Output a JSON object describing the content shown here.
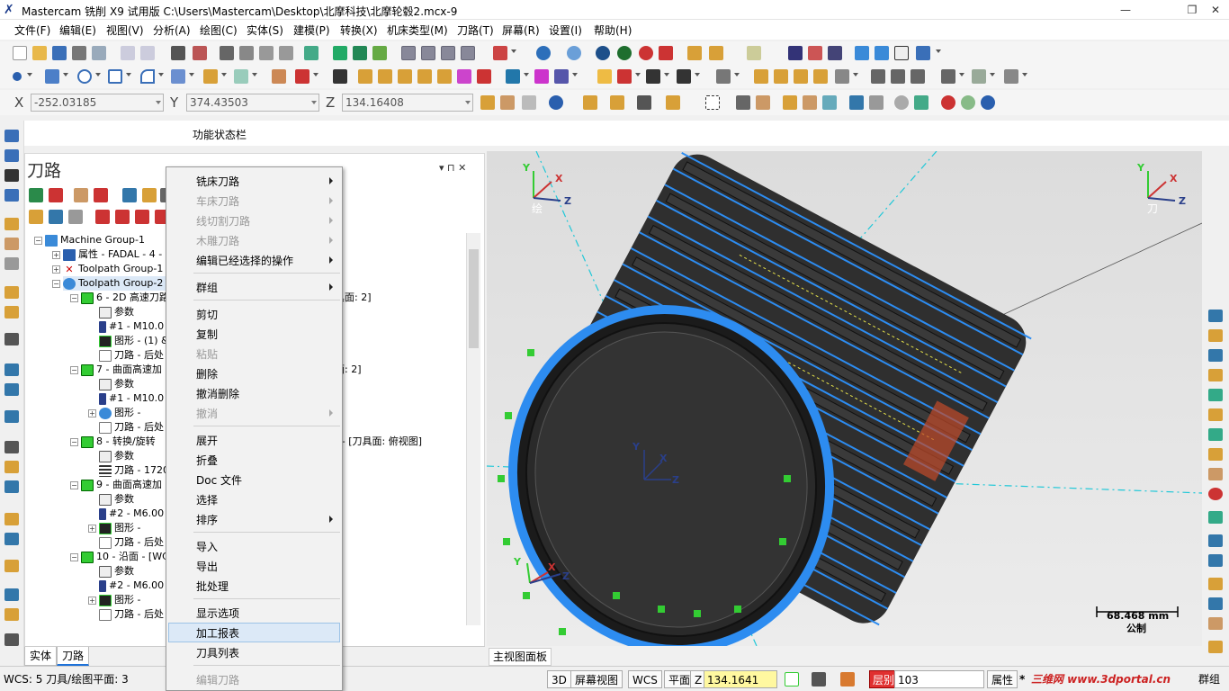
{
  "window": {
    "title": "Mastercam 铣削 X9 试用版  C:\\Users\\Mastercam\\Desktop\\北摩科技\\北摩轮毂2.mcx-9",
    "minimize": "—",
    "restore": "❐",
    "close": "✕"
  },
  "menu": [
    "文件(F)",
    "编辑(E)",
    "视图(V)",
    "分析(A)",
    "绘图(C)",
    "实体(S)",
    "建模(P)",
    "转换(X)",
    "机床类型(M)",
    "刀路(T)",
    "屏幕(R)",
    "设置(I)",
    "帮助(H)"
  ],
  "coords": {
    "x_label": "X",
    "x": "-252.03185",
    "y_label": "Y",
    "y": "374.43503",
    "z_label": "Z",
    "z": "134.16408"
  },
  "func_bar": "功能状态栏",
  "panel": {
    "title": "刀路",
    "pin": "▾ ⊓ ✕",
    "tree": [
      "Machine Group-1",
      "属性 - FADAL - 4 -",
      "Toolpath Group-1",
      "Toolpath Group-2",
      "6 - 2D 高速刀路",
      "参数",
      "#1 - M10.0",
      "图形 - (1) &",
      "刀路 - 后处",
      "7 - 曲面高速加",
      "参数",
      "#1 - M10.0",
      "图形 -",
      "刀路 - 后处",
      "8 - 转换/旋转",
      "参数",
      "刀路 - 1720",
      "9 - 曲面高速加",
      "参数",
      "#2 - M6.00",
      "图形 -",
      "刀路 - 后处",
      "10 - 沿面 - [WC",
      "参数",
      "#2 - M6.00",
      "图形 -",
      "刀路 - 后处"
    ],
    "tree_suffix": {
      "r6": "具面: 2]",
      "r7": "面: 2]",
      "r8": "] - [刀具面: 俯视图]",
      "r9": "]"
    },
    "tabs": [
      "实体",
      "刀路"
    ]
  },
  "context_menu": {
    "items": [
      {
        "label": "铣床刀路",
        "disabled": false,
        "sub": true
      },
      {
        "label": "车床刀路",
        "disabled": true,
        "sub": true
      },
      {
        "label": "线切割刀路",
        "disabled": true,
        "sub": true
      },
      {
        "label": "木雕刀路",
        "disabled": true,
        "sub": true
      },
      {
        "label": "编辑已经选择的操作",
        "disabled": false,
        "sub": true
      },
      {
        "label": "群组",
        "disabled": false,
        "sub": true
      },
      {
        "label": "剪切",
        "disabled": false,
        "sub": false
      },
      {
        "label": "复制",
        "disabled": false,
        "sub": false
      },
      {
        "label": "粘贴",
        "disabled": true,
        "sub": false
      },
      {
        "label": "删除",
        "disabled": false,
        "sub": false
      },
      {
        "label": "撤消删除",
        "disabled": false,
        "sub": false
      },
      {
        "label": "撤消",
        "disabled": true,
        "sub": true
      },
      {
        "label": "展开",
        "disabled": false,
        "sub": false
      },
      {
        "label": "折叠",
        "disabled": false,
        "sub": false
      },
      {
        "label": "Doc 文件",
        "disabled": false,
        "sub": false
      },
      {
        "label": "选择",
        "disabled": false,
        "sub": false
      },
      {
        "label": "排序",
        "disabled": false,
        "sub": true
      },
      {
        "label": "导入",
        "disabled": false,
        "sub": false
      },
      {
        "label": "导出",
        "disabled": false,
        "sub": false
      },
      {
        "label": "批处理",
        "disabled": false,
        "sub": false
      },
      {
        "label": "显示选项",
        "disabled": false,
        "sub": false
      },
      {
        "label": "加工报表",
        "disabled": false,
        "sub": false,
        "highlight": true
      },
      {
        "label": "刀具列表",
        "disabled": false,
        "sub": false
      },
      {
        "label": "编辑刀路",
        "disabled": true,
        "sub": false
      }
    ]
  },
  "viewport": {
    "view_left": "绘",
    "view_right": "刀",
    "scale_value": "68.468 mm",
    "scale_unit": "公制",
    "tab": "主视图面板",
    "axis_x": "X",
    "axis_y": "Y",
    "axis_z": "Z"
  },
  "status": {
    "wcs": "WCS: 5  刀具/绘图平面: 3",
    "mode3d": "3D",
    "screen_view": "屏幕视图",
    "wcs_btn": "WCS",
    "plane": "平面",
    "z_label": "Z",
    "z_value": "134.1641",
    "layer_label": "层别",
    "layer_value": "103",
    "attr": "属性",
    "attr_star": "*",
    "watermark": "三维网 www.3dportal.cn",
    "group": "群组"
  },
  "colors": {
    "accent_blue": "#1e72d8",
    "toolpath_blue": "#2d8cf0",
    "highlight": "#dce9f7",
    "z_field": "#fff8a0"
  }
}
